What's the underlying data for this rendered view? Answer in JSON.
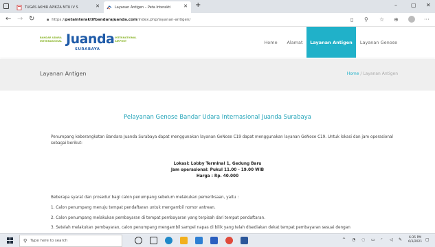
{
  "browser": {
    "tabs": [
      {
        "label": "TUGAS AKHIR APIKZA MTU IV S"
      },
      {
        "label": "Layanan Antigen – Peta Interakti"
      }
    ],
    "new_tab": "+",
    "window_controls": {
      "minimize": "–",
      "maximize": "▢",
      "close": "✕"
    },
    "address": {
      "prefix": "https://",
      "domain": "petainteraktifbandarajuanda.com",
      "path": "/index.php/layanan-antigen/"
    }
  },
  "site": {
    "logo": {
      "left_line1": "BANDAR UDARA",
      "left_line2": "INTERNASIONAL",
      "main": "Juanda",
      "right_line1": "INTERNATIONAL",
      "right_line2": "AIRPORT",
      "sub": "SURABAYA"
    },
    "menu": [
      {
        "label": "Home",
        "active": false
      },
      {
        "label": "Alamat",
        "active": false
      },
      {
        "label": "Layanan Antigen",
        "active": true
      },
      {
        "label": "Layanan Genose",
        "active": false
      }
    ],
    "accent": "#20b1c9"
  },
  "banner": {
    "title": "Layanan Antigen",
    "breadcrumb_home": "Home",
    "breadcrumb_sep": "/",
    "breadcrumb_current": "Layanan Antigen"
  },
  "content": {
    "heading": "Pelayanan Genose Bandar Udara Internasional Juanda Surabaya",
    "intro": "Penumpang keberangkatan Bandara Juanda Surabaya dapat menggunakan layanan GeNose C19 dapat menggunakan layanan GeNose C19. Untuk lokasi dan jam operasional sebagai berikut:",
    "location": "Lokasi: Lobby Terminal 1, Gedung Baru",
    "hours": "Jam operasional: Pukul 11.00 - 19.00 WIB",
    "price": "Harga : Rp. 40.000",
    "steps_intro": "Beberapa syarat dan prosedur bagi calon penumpang sebelum melakukan pemeriksaan, yaitu :",
    "steps": [
      "1. Calon penumpang menuju tempat pendaftaran untuk mengambil nomor antrean.",
      "2. Calon penumpang melakukan pembayaran di tempat pembayaran yang terpisah dari tempat pendaftaran.",
      "3. Setelah melakukan pembayaran, calon penumpang mengambil sampel napas di bilik yang telah disediakan dekat tempat pembayaran sesuai dengan"
    ]
  },
  "taskbar": {
    "search_placeholder": "Type here to search",
    "time": "6:35 PM",
    "date": "6/3/2021"
  }
}
